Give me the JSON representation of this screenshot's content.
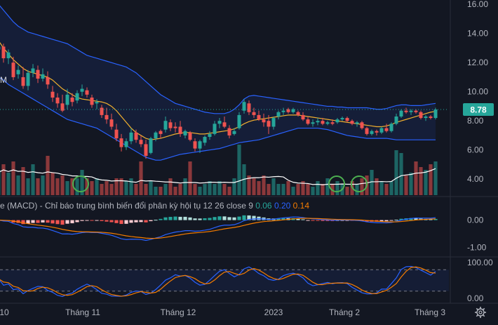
{
  "chart_data": [
    {
      "type": "candlestick",
      "panel": "price",
      "ylim": [
        2.9,
        16.3
      ],
      "y_ticks": [
        "16.00",
        "14.00",
        "12.00",
        "10.00",
        "8.00",
        "6.00",
        "4.00"
      ],
      "last_price_label": "8.78",
      "last_price": 8.78,
      "stray_label": "M",
      "colors": {
        "up": "#26a69a",
        "down": "#ef5350",
        "bollinger": "#2962ff",
        "ma": "#f2b02e",
        "volume_ma": "#ffffff"
      },
      "candles": [
        [
          12.9,
          13.6,
          12.5,
          13.1
        ],
        [
          13.1,
          13.3,
          12.0,
          12.3
        ],
        [
          12.3,
          12.9,
          11.9,
          12.7
        ],
        [
          12.0,
          12.4,
          10.8,
          11.0
        ],
        [
          11.2,
          11.8,
          10.9,
          11.5
        ],
        [
          11.0,
          11.7,
          10.2,
          10.4
        ],
        [
          10.4,
          11.5,
          10.1,
          11.3
        ],
        [
          11.3,
          11.9,
          11.0,
          11.6
        ],
        [
          11.5,
          11.8,
          10.6,
          10.9
        ],
        [
          10.9,
          11.6,
          10.7,
          11.2
        ],
        [
          11.0,
          11.4,
          10.2,
          10.5
        ],
        [
          10.0,
          10.4,
          9.3,
          9.6
        ],
        [
          9.6,
          9.9,
          8.9,
          9.2
        ],
        [
          9.2,
          9.8,
          8.6,
          8.7
        ],
        [
          9.1,
          10.2,
          8.8,
          9.8
        ],
        [
          9.6,
          9.9,
          9.0,
          9.3
        ],
        [
          9.4,
          10.1,
          9.2,
          9.9
        ],
        [
          10.0,
          10.5,
          9.7,
          10.2
        ],
        [
          10.1,
          10.3,
          9.6,
          9.8
        ],
        [
          9.6,
          9.8,
          8.9,
          9.1
        ],
        [
          9.2,
          9.5,
          8.8,
          9.3
        ],
        [
          8.9,
          9.1,
          8.2,
          8.4
        ],
        [
          8.4,
          8.9,
          7.8,
          8.1
        ],
        [
          8.1,
          8.5,
          7.4,
          7.6
        ],
        [
          7.4,
          7.8,
          6.6,
          6.8
        ],
        [
          6.8,
          7.1,
          5.9,
          6.2
        ],
        [
          6.2,
          6.8,
          6.0,
          6.6
        ],
        [
          6.6,
          7.5,
          6.4,
          7.2
        ],
        [
          7.2,
          7.4,
          6.5,
          6.7
        ],
        [
          6.7,
          7.0,
          6.2,
          6.4
        ],
        [
          6.4,
          6.7,
          5.4,
          5.6
        ],
        [
          5.8,
          6.9,
          5.7,
          6.8
        ],
        [
          6.8,
          7.3,
          6.6,
          7.2
        ],
        [
          7.3,
          7.4,
          6.8,
          7.1
        ],
        [
          7.4,
          8.3,
          7.2,
          8.0
        ],
        [
          7.9,
          8.1,
          7.3,
          7.5
        ],
        [
          7.6,
          7.9,
          7.2,
          7.5
        ],
        [
          7.6,
          8.0,
          6.9,
          7.1
        ],
        [
          7.0,
          7.4,
          6.8,
          7.3
        ],
        [
          7.2,
          7.3,
          6.6,
          6.7
        ],
        [
          6.6,
          6.8,
          5.9,
          6.1
        ],
        [
          6.1,
          6.7,
          5.8,
          6.6
        ],
        [
          6.5,
          7.0,
          6.3,
          6.9
        ],
        [
          6.9,
          7.3,
          6.7,
          7.1
        ],
        [
          7.1,
          8.0,
          7.0,
          7.8
        ],
        [
          7.8,
          8.2,
          7.5,
          8.0
        ],
        [
          7.9,
          8.3,
          7.5,
          7.6
        ],
        [
          7.5,
          7.7,
          6.8,
          7.0
        ],
        [
          7.1,
          7.5,
          7.0,
          7.3
        ],
        [
          7.5,
          8.6,
          7.4,
          8.4
        ],
        [
          8.7,
          9.5,
          8.5,
          9.3
        ],
        [
          9.2,
          9.4,
          8.4,
          8.6
        ],
        [
          8.6,
          8.9,
          8.2,
          8.4
        ],
        [
          8.4,
          8.7,
          8.0,
          8.1
        ],
        [
          8.1,
          8.5,
          7.6,
          7.9
        ],
        [
          8.0,
          8.4,
          7.1,
          7.6
        ],
        [
          7.6,
          8.3,
          7.4,
          8.2
        ],
        [
          8.3,
          8.7,
          8.1,
          8.6
        ],
        [
          8.6,
          8.9,
          8.4,
          8.7
        ],
        [
          8.8,
          8.9,
          8.5,
          8.6
        ],
        [
          8.6,
          8.9,
          8.5,
          8.8
        ],
        [
          8.6,
          8.7,
          8.3,
          8.4
        ],
        [
          8.4,
          8.6,
          8.0,
          8.1
        ],
        [
          8.1,
          8.3,
          7.7,
          7.8
        ],
        [
          7.8,
          8.1,
          7.6,
          7.9
        ],
        [
          7.9,
          8.2,
          7.7,
          8.0
        ],
        [
          8.0,
          8.2,
          7.7,
          7.8
        ],
        [
          7.8,
          8.0,
          7.7,
          7.9
        ],
        [
          7.9,
          8.1,
          7.7,
          7.8
        ],
        [
          7.9,
          8.2,
          7.8,
          8.1
        ],
        [
          8.1,
          8.3,
          8.0,
          8.2
        ],
        [
          8.2,
          8.3,
          7.9,
          8.0
        ],
        [
          8.0,
          8.1,
          7.7,
          7.8
        ],
        [
          7.8,
          8.0,
          7.6,
          7.9
        ],
        [
          7.9,
          8.0,
          7.4,
          7.5
        ],
        [
          7.5,
          7.6,
          7.0,
          7.1
        ],
        [
          7.1,
          7.4,
          7.0,
          7.3
        ],
        [
          7.3,
          7.4,
          7.0,
          7.2
        ],
        [
          7.2,
          7.6,
          7.1,
          7.5
        ],
        [
          7.5,
          7.8,
          7.2,
          7.3
        ],
        [
          7.3,
          7.9,
          7.2,
          7.8
        ],
        [
          7.8,
          8.5,
          7.7,
          8.3
        ],
        [
          8.3,
          8.8,
          8.2,
          8.7
        ],
        [
          8.7,
          8.9,
          8.5,
          8.6
        ],
        [
          8.6,
          8.8,
          8.4,
          8.7
        ],
        [
          8.7,
          8.8,
          8.5,
          8.6
        ],
        [
          8.6,
          8.7,
          8.1,
          8.2
        ],
        [
          8.2,
          8.4,
          8.0,
          8.3
        ],
        [
          8.3,
          8.4,
          8.1,
          8.2
        ],
        [
          8.2,
          8.9,
          8.1,
          8.78
        ]
      ],
      "bollinger_upper": [
        16.0,
        15.6,
        15.2,
        14.8,
        14.5,
        14.3,
        14.1,
        14.0,
        13.9,
        13.8,
        13.7,
        13.6,
        13.5,
        13.4,
        13.3,
        13.1,
        12.9,
        12.7,
        12.5,
        12.4,
        12.3,
        12.2,
        12.1,
        12.0,
        11.9,
        11.8,
        11.7,
        11.5,
        11.3,
        11.0,
        10.7,
        10.4,
        10.1,
        9.8,
        9.6,
        9.4,
        9.2,
        9.1,
        9.0,
        8.9,
        8.8,
        8.7,
        8.6,
        8.55,
        8.5,
        8.5,
        8.5,
        8.6,
        8.8,
        9.1,
        9.5,
        9.7,
        9.75,
        9.7,
        9.65,
        9.6,
        9.55,
        9.5,
        9.45,
        9.4,
        9.35,
        9.3,
        9.25,
        9.2,
        9.15,
        9.1,
        9.05,
        9.0,
        9.0,
        8.95,
        8.95,
        8.9,
        8.9,
        8.9,
        8.9,
        8.9,
        8.85,
        8.8,
        8.8,
        8.85,
        8.95,
        9.05,
        9.1,
        9.1,
        9.05,
        9.05,
        9.05,
        9.1,
        9.15,
        9.2
      ],
      "bollinger_lower": [
        11.0,
        10.8,
        10.5,
        10.3,
        10.1,
        9.9,
        9.7,
        9.5,
        9.3,
        9.1,
        8.9,
        8.7,
        8.5,
        8.3,
        8.1,
        8.0,
        7.9,
        7.8,
        7.7,
        7.6,
        7.5,
        7.3,
        7.1,
        6.9,
        6.7,
        6.5,
        6.3,
        6.1,
        5.9,
        5.7,
        5.5,
        5.4,
        5.3,
        5.3,
        5.4,
        5.5,
        5.6,
        5.7,
        5.75,
        5.8,
        5.85,
        5.9,
        5.95,
        6.0,
        6.05,
        6.1,
        6.2,
        6.3,
        6.4,
        6.5,
        6.55,
        6.6,
        6.65,
        6.7,
        6.8,
        6.9,
        7.0,
        7.1,
        7.2,
        7.3,
        7.4,
        7.5,
        7.5,
        7.5,
        7.5,
        7.5,
        7.45,
        7.4,
        7.3,
        7.2,
        7.1,
        7.0,
        6.95,
        6.9,
        6.85,
        6.8,
        6.8,
        6.8,
        6.8,
        6.8,
        6.75,
        6.7,
        6.7,
        6.7,
        6.7,
        6.7,
        6.7,
        6.7,
        6.7,
        6.7
      ],
      "ma": [
        13.5,
        13.0,
        12.6,
        12.2,
        11.9,
        11.6,
        11.4,
        11.3,
        11.2,
        11.1,
        11.0,
        10.8,
        10.5,
        10.2,
        10.0,
        9.8,
        9.6,
        9.5,
        9.45,
        9.4,
        9.35,
        9.3,
        9.2,
        9.0,
        8.7,
        8.3,
        7.9,
        7.5,
        7.2,
        7.0,
        6.8,
        6.7,
        6.75,
        6.8,
        6.9,
        7.0,
        7.1,
        7.15,
        7.2,
        7.2,
        7.15,
        7.1,
        7.1,
        7.15,
        7.2,
        7.25,
        7.3,
        7.35,
        7.45,
        7.6,
        7.8,
        7.95,
        8.05,
        8.1,
        8.15,
        8.2,
        8.25,
        8.3,
        8.35,
        8.4,
        8.4,
        8.4,
        8.35,
        8.3,
        8.25,
        8.2,
        8.15,
        8.1,
        8.05,
        8.0,
        7.95,
        7.9,
        7.85,
        7.8,
        7.75,
        7.7,
        7.65,
        7.6,
        7.6,
        7.65,
        7.75,
        7.9,
        8.0,
        8.1,
        8.2,
        8.3,
        8.4,
        8.5,
        8.6,
        8.65
      ],
      "volume": [
        0.45,
        0.55,
        0.4,
        0.6,
        0.35,
        0.5,
        0.3,
        0.55,
        0.3,
        0.35,
        0.7,
        0.4,
        0.3,
        0.35,
        0.25,
        0.3,
        0.3,
        0.45,
        0.3,
        0.25,
        0.3,
        0.2,
        0.25,
        0.2,
        0.3,
        0.3,
        0.25,
        0.3,
        0.2,
        0.6,
        0.2,
        0.25,
        0.15,
        0.15,
        0.2,
        0.3,
        0.15,
        0.2,
        0.3,
        0.6,
        0.2,
        0.15,
        0.2,
        0.25,
        0.2,
        0.25,
        0.2,
        0.15,
        0.3,
        0.9,
        0.55,
        0.35,
        0.3,
        0.25,
        0.35,
        0.2,
        0.3,
        0.2,
        0.2,
        0.25,
        0.15,
        0.2,
        0.25,
        0.2,
        0.15,
        0.25,
        0.2,
        0.3,
        0.2,
        0.25,
        0.2,
        0.15,
        0.25,
        0.2,
        0.3,
        0.35,
        0.45,
        0.3,
        0.25,
        0.2,
        0.25,
        0.8,
        0.75,
        0.35,
        0.4,
        0.6,
        0.5,
        0.45,
        0.55,
        0.6
      ]
    },
    {
      "type": "macd",
      "panel": "macd",
      "legend_name": "e (MACD) - Chỉ báo trung bình biến đổi phân kỳ hội tụ",
      "params": "12 26 close 9",
      "values_text": {
        "histogram": "0.06",
        "macd": "0.20",
        "signal": "0.14"
      },
      "colors": {
        "macd": "#2962ff",
        "signal": "#f57c00",
        "hist_up": "#26a69a",
        "hist_down": "#ef5350"
      },
      "y_ticks": [
        "0.00",
        "-1.00"
      ],
      "ylim": [
        -1.25,
        0.35
      ]
    },
    {
      "type": "stochastic",
      "panel": "oscillator",
      "y_ticks": [
        "100.00",
        "0.00"
      ],
      "ylim": [
        -10,
        112
      ],
      "bands": [
        80,
        20
      ],
      "colors": {
        "k": "#2962ff",
        "d": "#f57c00",
        "band_fill": "rgba(41,98,255,0.09)"
      }
    }
  ],
  "x_axis": {
    "labels": [
      "10",
      "Tháng 11",
      "Tháng 12",
      "2023",
      "Tháng 2",
      "Tháng 3"
    ]
  },
  "ui": {
    "settings_icon": "gear-icon"
  }
}
